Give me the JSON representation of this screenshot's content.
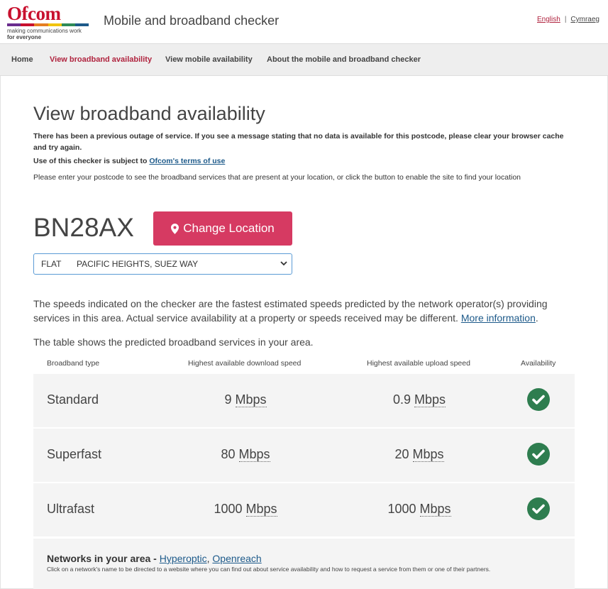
{
  "header": {
    "logo": {
      "word": "Ofcom",
      "tagline1": "making communications work",
      "tagline2": "for everyone"
    },
    "title": "Mobile and broadband checker",
    "languages": {
      "english": "English",
      "separator": "|",
      "welsh": "Cymraeg"
    }
  },
  "nav": {
    "items": [
      {
        "label": "Home",
        "active": false
      },
      {
        "label": "View broadband availability",
        "active": true
      },
      {
        "label": "View mobile availability",
        "active": false
      },
      {
        "label": "About the mobile and broadband checker",
        "active": false
      }
    ]
  },
  "main": {
    "title": "View broadband availability",
    "notice": "There has been a previous outage of service. If you see a message stating that no data is available for this postcode, please clear your browser cache and try again.",
    "terms_prefix": "Use of this checker is subject to",
    "terms_link": "Ofcom's terms of use",
    "instruction": "Please enter your postcode to see the broadband services that are present at your location, or click the button to enable the site to find your location",
    "postcode": "BN28AX",
    "change_location_label": "Change Location",
    "address_select": {
      "flat": "FLAT",
      "address": "PACIFIC HEIGHTS, SUEZ WAY"
    },
    "disclaimer": "The speeds indicated on the checker are the fastest estimated speeds predicted by the network operator(s) providing services in this area. Actual service availability at a property or speeds received may be different.",
    "more_info_link": "More information",
    "disclaimer_end": ".",
    "table_intro": "The table shows the predicted broadband services in your area."
  },
  "table": {
    "headers": [
      "Broadband type",
      "Highest available download speed",
      "Highest available upload speed",
      "Availability"
    ],
    "rows": [
      {
        "type": "Standard",
        "download": "9",
        "download_unit": "Mbps",
        "upload": "0.9",
        "upload_unit": "Mbps",
        "available": true
      },
      {
        "type": "Superfast",
        "download": "80",
        "download_unit": "Mbps",
        "upload": "20",
        "upload_unit": "Mbps",
        "available": true
      },
      {
        "type": "Ultrafast",
        "download": "1000",
        "download_unit": "Mbps",
        "upload": "1000",
        "upload_unit": "Mbps",
        "available": true
      }
    ]
  },
  "networks": {
    "title": "Networks in your area -",
    "links": [
      "Hyperoptic",
      "Openreach"
    ],
    "link_separator": ", ",
    "note": "Click on a network's name to be directed to a website where you can find out about service availability and how to request a service from them or one of their partners."
  },
  "colors": {
    "brand": "#c8102e",
    "nav_active": "#b0243f",
    "button": "#d63a62",
    "check": "#2e7d4f",
    "link": "#1d5a8a"
  },
  "icons": {
    "pin": "map-marker-icon",
    "check": "check-circle-icon",
    "select": "chevron-down-icon"
  }
}
